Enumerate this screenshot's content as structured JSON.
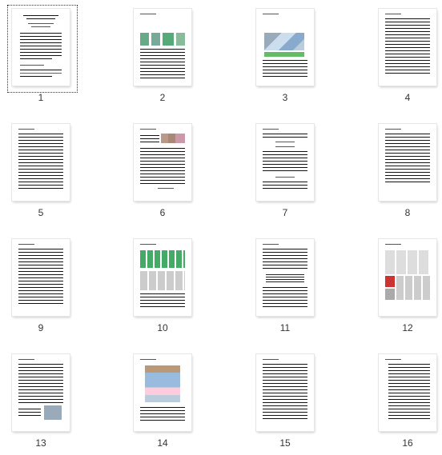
{
  "view": "thumbnail-grid",
  "selected_page": "1",
  "pages": [
    {
      "label": "1",
      "content": "text-title"
    },
    {
      "label": "2",
      "content": "text-figure"
    },
    {
      "label": "3",
      "content": "text-figure"
    },
    {
      "label": "4",
      "content": "text"
    },
    {
      "label": "5",
      "content": "text"
    },
    {
      "label": "6",
      "content": "text-figure"
    },
    {
      "label": "7",
      "content": "text-equations"
    },
    {
      "label": "8",
      "content": "text"
    },
    {
      "label": "9",
      "content": "text"
    },
    {
      "label": "10",
      "content": "figure"
    },
    {
      "label": "11",
      "content": "text-table"
    },
    {
      "label": "12",
      "content": "figure"
    },
    {
      "label": "13",
      "content": "text-figure"
    },
    {
      "label": "14",
      "content": "figure"
    },
    {
      "label": "15",
      "content": "text"
    },
    {
      "label": "16",
      "content": "references"
    }
  ]
}
